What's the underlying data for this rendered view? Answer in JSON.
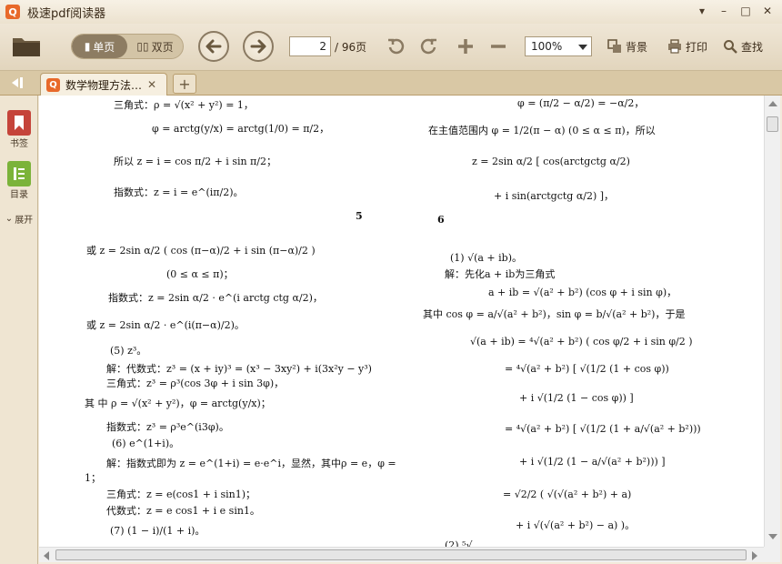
{
  "app": {
    "title": "极速pdf阅读器",
    "icon_letter": "Q"
  },
  "window_controls": {
    "menu": "▾",
    "minimize": "–",
    "maximize": "□",
    "close": "✕"
  },
  "toolbar": {
    "single_page": "单页",
    "double_page": "双页",
    "current_page": "2",
    "total_pages": "/ 96页",
    "zoom": "100%",
    "background": "背景",
    "print": "打印",
    "find": "查找"
  },
  "tabs": {
    "document": "数学物理方法…",
    "close": "✕",
    "add": "+"
  },
  "sidebar": {
    "bookmarks": "书签",
    "toc": "目录",
    "expand": "展开"
  },
  "page": {
    "left_lines": [
      "三角式：ρ = √(x² + y²) = 1，",
      "φ = arctg(y/x) = arctg(1/0) = π/2，",
      "所以    z = i = cos π/2 + i sin π/2；",
      "指数式：z = i = e^(iπ/2)。",
      "或        z = 2sin α/2 ( cos (π−α)/2 + i sin (π−α)/2 )",
      "(0 ≤ α ≤ π)；",
      "指数式：z = 2sin α/2 · e^(i arctg ctg α/2)，",
      "或        z = 2sin α/2 · e^(i(π−α)/2)。",
      "(5)  z³。",
      "解：代数式：z³ = (x + iy)³ = (x³ − 3xy²) + i(3x²y − y³)",
      "三角式：z³ = ρ³(cos 3φ + i sin 3φ)，",
      "其 中 ρ = √(x² + y²)，φ = arctg(y/x)；",
      "指数式：z³ = ρ³e^(i3φ)。",
      "(6)  e^(1+i)。",
      "解：指数式即为 z = e^(1+i) = e·e^i，显然，其中ρ = e，φ =",
      "1；",
      "三角式：z = e(cos1 + i sin1)；",
      "代数式：z = e cos1 + i e sin1。",
      "(7)  (1 − i)/(1 + i)。"
    ],
    "right_lines": [
      "φ = (π/2 − α/2) = −α/2，",
      "在主值范围内 φ = 1/2(π − α)  (0 ≤ α ≤ π)，所以",
      "z = 2sin α/2 [ cos(arctgctg α/2)",
      "+ i sin(arctgctg α/2) ]，",
      "(1)  √(a + ib)。",
      "解：先化a + ib为三角式",
      "a + ib = √(a² + b²) (cos φ + i sin φ)，",
      "其中   cos φ = a/√(a² + b²)，sin φ = b/√(a² + b²)，于是",
      "√(a + ib) = ⁴√(a² + b²) ( cos φ/2 + i sin φ/2 )",
      "= ⁴√(a² + b²) [ √(1/2 (1 + cos φ))",
      "+ i √(1/2 (1 − cos φ)) ]",
      "= ⁴√(a² + b²) [ √(1/2 (1 + a/√(a² + b²)))",
      "+ i √(1/2 (1 − a/√(a² + b²))) ]",
      "= √2/2 ( √(√(a² + b²) + a)",
      "+ i √(√(a² + b²) − a) )。",
      "(2)  ⁵√…"
    ],
    "marker_5": "5",
    "marker_6": "6"
  },
  "colors": {
    "accent": "#e8692a",
    "toolbar_bg": "#e8dcc6",
    "tab_bar": "#d9c8a5"
  }
}
